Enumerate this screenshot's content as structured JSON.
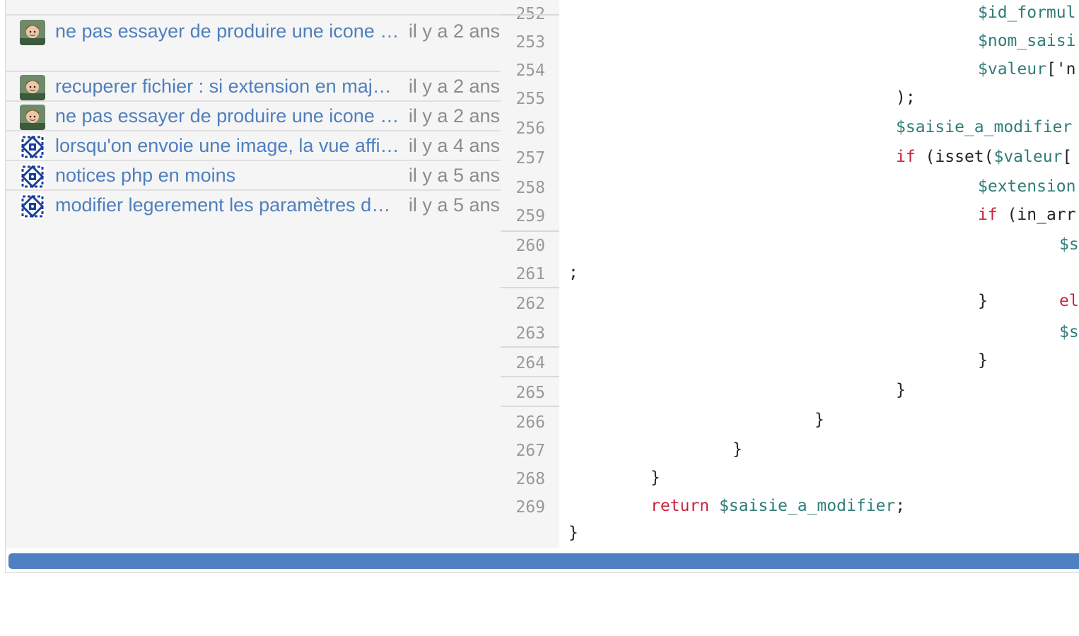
{
  "blame": [
    {
      "avatar": "photo-avatar-icon",
      "message": "ne pas essayer de produire une icone pour les fichiers",
      "age": "il y a 2 ans"
    },
    {
      "avatar": "photo-avatar-icon",
      "message": "recuperer fichier : si extension en majuscule",
      "age": "il y a 2 ans"
    },
    {
      "avatar": "photo-avatar-icon",
      "message": "ne pas essayer de produire une icone pour les fichiers",
      "age": "il y a 2 ans"
    },
    {
      "avatar": "pattern-avatar-icon",
      "message": "lorsqu'on envoie une image, la vue affiche",
      "age": "il y a 4 ans"
    },
    {
      "avatar": "pattern-avatar-icon",
      "message": "notices php en moins",
      "age": "il y a 5 ans"
    },
    {
      "avatar": "pattern-avatar-icon",
      "message": "modifier legerement les paramètres de la saisie",
      "age": "il y a 5 ans"
    }
  ],
  "line_numbers": [
    "252",
    "253",
    "254",
    "255",
    "256",
    "257",
    "258",
    "259",
    "260",
    "261",
    "262",
    "263",
    "264",
    "265",
    "266",
    "267",
    "268",
    "269"
  ],
  "code": {
    "l252": {
      "var": "$id_formul"
    },
    "l253": {
      "var": "$nom_saisi"
    },
    "l254": {
      "var": "$valeur",
      "rest": "['n"
    },
    "l255": {
      "text": ");"
    },
    "l256": {
      "var": "$saisie_a_modifier"
    },
    "l257": {
      "kw": "if",
      "mid": " (isset(",
      "var": "$valeur",
      "rest": "["
    },
    "l258": {
      "var": "$extension"
    },
    "l259": {
      "kw": "if",
      "rest": " (in_arr"
    },
    "l260": {
      "var": "$s"
    },
    "l261": {
      "text": ";"
    },
    "l262": {
      "brace": "}",
      "kw": "el"
    },
    "l263": {
      "var": "$s"
    },
    "l264": {
      "text": "}"
    },
    "l265": {
      "text": "}"
    },
    "l266": {
      "text": "}"
    },
    "l267": {
      "text": "}"
    },
    "l268": {
      "text": "}"
    },
    "l269": {
      "kw": "return",
      "var": "$saisie_a_modifier",
      "rest": ";"
    },
    "l270": {
      "text": "}"
    }
  },
  "colors": {
    "link": "#4e7fbe",
    "muted": "#8b8b8b",
    "variable": "#2f7c79",
    "keyword": "#c8263e",
    "scrollbar": "#4f80c1"
  }
}
